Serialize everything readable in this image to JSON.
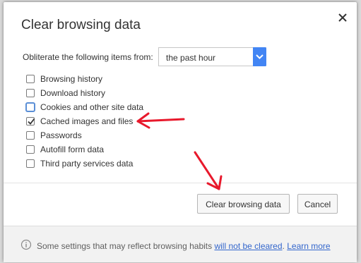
{
  "dialog": {
    "title": "Clear browsing data",
    "from_label": "Obliterate the following items from:",
    "time_range": "the past hour",
    "items": [
      {
        "label": "Browsing history",
        "checked": false
      },
      {
        "label": "Download history",
        "checked": false
      },
      {
        "label": "Cookies and other site data",
        "checked": false
      },
      {
        "label": "Cached images and files",
        "checked": true
      },
      {
        "label": "Passwords",
        "checked": false
      },
      {
        "label": "Autofill form data",
        "checked": false
      },
      {
        "label": "Third party services data",
        "checked": false
      }
    ],
    "clear_button": "Clear browsing data",
    "cancel_button": "Cancel"
  },
  "footer": {
    "text": "Some settings that may reflect browsing habits",
    "link1": "will not be cleared",
    "sep": ".",
    "link2": "Learn more"
  },
  "colors": {
    "accent": "#4285f4",
    "annotation_arrow": "#e8192c",
    "link": "#3366cc"
  },
  "icons": {
    "close": "close-icon",
    "dropdown": "chevron-down-icon",
    "info": "info-icon",
    "check": "check-icon"
  }
}
